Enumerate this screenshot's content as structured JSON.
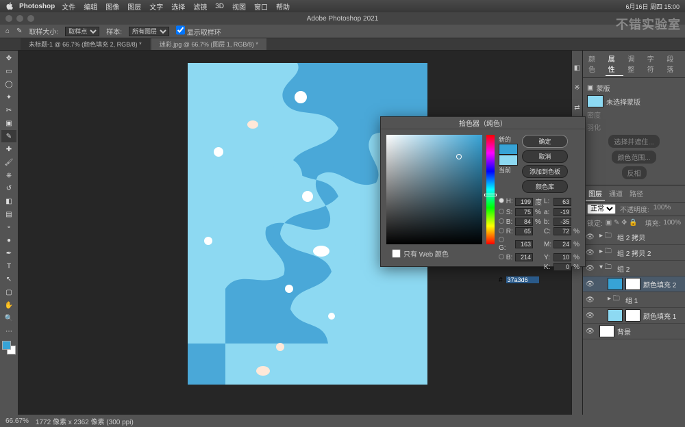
{
  "menubar": {
    "app": "Photoshop",
    "items": [
      "文件",
      "编辑",
      "图像",
      "图层",
      "文字",
      "选择",
      "滤镜",
      "3D",
      "视图",
      "窗口",
      "帮助"
    ],
    "clock": "6月16日 周四 15:00"
  },
  "titlebar": {
    "title": "Adobe Photoshop 2021"
  },
  "optbar": {
    "sample_size_label": "取样大小:",
    "sample_size_value": "取样点",
    "sample_label": "样本:",
    "sample_value": "所有图层",
    "show_ring": "显示取样环"
  },
  "tabs": [
    "未标题-1 @ 66.7% (颜色填充 2, RGB/8) *",
    "迷彩.jpg @ 66.7% (图层 1, RGB/8) *"
  ],
  "panels": {
    "top_tabs": [
      "颜色",
      "属性",
      "调整",
      "字符",
      "段落"
    ],
    "prop_title": "蒙版",
    "mask_status": "未选择蒙版",
    "density": "密度",
    "feather": "羽化",
    "refine": "选择并遮住...",
    "color_range": "颜色范围...",
    "invert": "反相",
    "layer_tabs": [
      "图层",
      "通道",
      "路径"
    ],
    "blend": "正常",
    "opacity_label": "不透明度:",
    "opacity": "100%",
    "lock_label": "锁定:",
    "fill_label": "填充:",
    "fill": "100%"
  },
  "layers": [
    {
      "name": "组 2 拷贝",
      "type": "folder",
      "indent": 0
    },
    {
      "name": "组 2 拷贝 2",
      "type": "folder",
      "indent": 0
    },
    {
      "name": "组 2",
      "type": "folder",
      "indent": 0,
      "expanded": true
    },
    {
      "name": "颜色填充 2",
      "type": "fill",
      "indent": 1,
      "selected": true,
      "color": "#37a3d6"
    },
    {
      "name": "组 1",
      "type": "folder",
      "indent": 1
    },
    {
      "name": "颜色填充 1",
      "type": "fill",
      "indent": 1,
      "color": "#8dd9f2"
    },
    {
      "name": "背景",
      "type": "bg",
      "indent": 0
    }
  ],
  "picker": {
    "title": "拾色器（纯色）",
    "ok": "确定",
    "cancel": "取消",
    "add_swatch": "添加到色板",
    "libraries": "颜色库",
    "new_label": "新的",
    "current_label": "当前",
    "web_only": "只有 Web 颜色",
    "H": "199",
    "S": "75",
    "B": "84",
    "R": "65",
    "G": "163",
    "Bb": "214",
    "L": "63",
    "a": "-19",
    "b2": "-35",
    "C": "72",
    "M": "24",
    "Y": "10",
    "K": "0",
    "hex": "37a3d6",
    "deg": "度",
    "pct": "%"
  },
  "statusbar": {
    "zoom": "66.67%",
    "doc": "1772 像素 x 2362 像素 (300 ppi)"
  },
  "watermark": "不错实验室"
}
